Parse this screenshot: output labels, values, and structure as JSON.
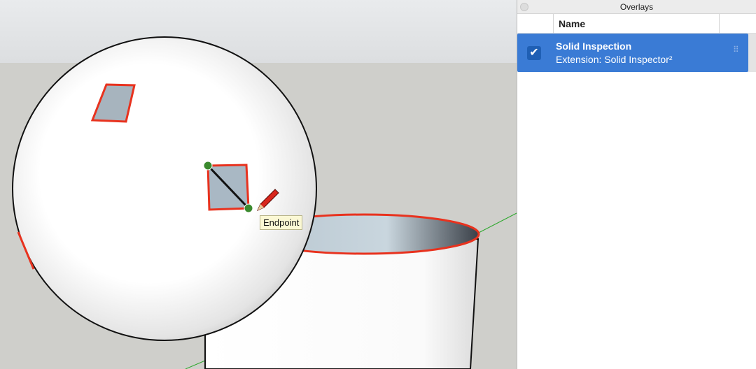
{
  "viewport": {
    "tooltip": "Endpoint",
    "colors": {
      "ground": "#cfcfcb",
      "sky": "#e4e6e8",
      "error_edge": "#e8321e",
      "axis_green": "#2ea82e"
    }
  },
  "panel": {
    "title": "Overlays",
    "column_header": "Name",
    "rows": [
      {
        "name": "Solid Inspection",
        "source": "Extension: Solid Inspector²",
        "checked": true
      }
    ],
    "accent": "#3a7bd5"
  }
}
